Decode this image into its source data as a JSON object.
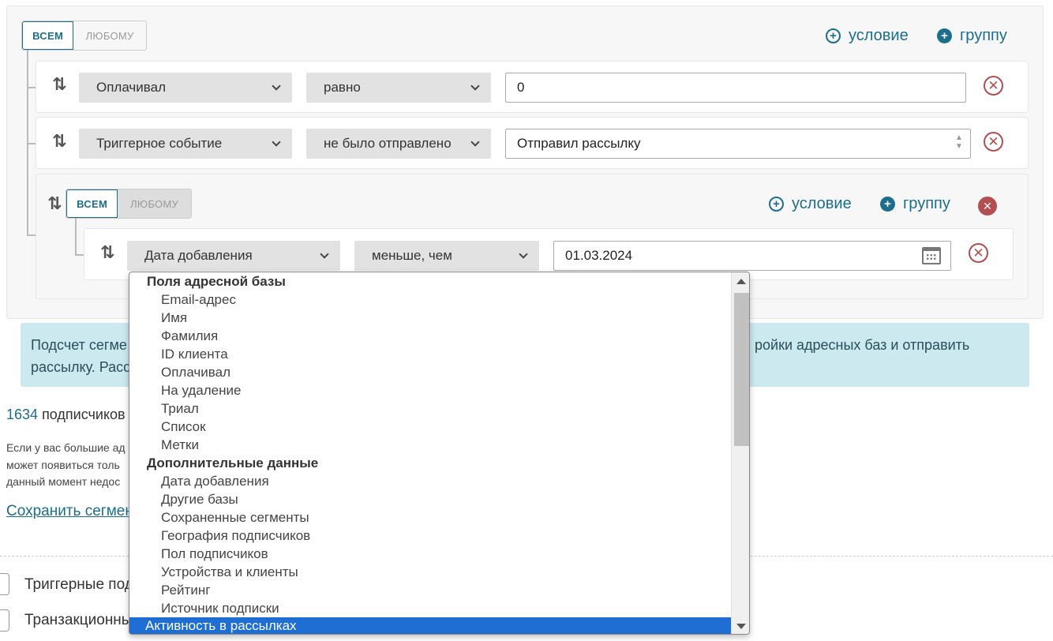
{
  "builder": {
    "toggle": {
      "all": "ВСЕМ",
      "any": "ЛЮБОМУ"
    },
    "add_condition": "условие",
    "add_group": "группу",
    "rows": [
      {
        "field": "Оплачивал",
        "operator": "равно",
        "value": "0"
      },
      {
        "field": "Триггерное событие",
        "operator": "не было отправлено",
        "value": "Отправил рассылку"
      }
    ],
    "subgroup": {
      "toggle": {
        "all": "ВСЕМ",
        "any": "ЛЮБОМУ"
      },
      "add_condition": "условие",
      "add_group": "группу",
      "row": {
        "field": "Дата добавления",
        "operator": "меньше, чем",
        "value": "01.03.2024"
      }
    }
  },
  "info": {
    "line1_left": "Подсчет сегме",
    "line1_right": "ройки адресных баз и отправить",
    "line2_left": "рассылку. Расс"
  },
  "summary": {
    "count": "1634",
    "count_label": "подписчиков",
    "note_lines": [
      "Если у вас большие ад",
      "может появиться толь",
      "данный момент недос"
    ],
    "save_link": "Сохранить сегмент"
  },
  "checkboxes": [
    {
      "label": "Триггерные подписки"
    },
    {
      "label": "Транзакционные"
    }
  ],
  "dropdown": {
    "groups": [
      {
        "title": "Поля адресной базы",
        "items": [
          "Email-адрес",
          "Имя",
          "Фамилия",
          "ID клиента",
          "Оплачивал",
          "На удаление",
          "Триал",
          "Список",
          "Метки"
        ]
      },
      {
        "title": "Дополнительные данные",
        "items": [
          "Дата добавления",
          "Другие базы",
          "Сохраненные сегменты",
          "География подписчиков",
          "Пол подписчиков",
          "Устройства и клиенты",
          "Рейтинг",
          "Источник подписки"
        ]
      }
    ],
    "highlighted": "Активность в рассылках"
  },
  "colors": {
    "accent": "#1c6e8c",
    "danger": "#b24f52",
    "info_bg": "#cbe9ef",
    "highlight": "#1f6ed4"
  }
}
